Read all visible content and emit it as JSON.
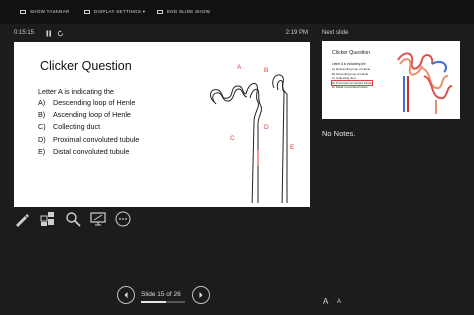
{
  "topbar": {
    "show_taskbar": "SHOW TASKBAR",
    "display_settings": "DISPLAY SETTINGS ▾",
    "end_slide_show": "END SLIDE SHOW"
  },
  "timer": {
    "elapsed": "0:15:15",
    "clock": "2:19 PM"
  },
  "slide": {
    "title": "Clicker Question",
    "question": "Letter A is indicating the",
    "options": [
      {
        "letter": "A)",
        "text": "Descending loop of Henle"
      },
      {
        "letter": "B)",
        "text": "Ascending loop of Henle"
      },
      {
        "letter": "C)",
        "text": "Collecting duct"
      },
      {
        "letter": "D)",
        "text": "Proximal convoluted tubule"
      },
      {
        "letter": "E)",
        "text": "Distal convoluted tubule"
      }
    ],
    "diagram_labels": {
      "a": "A",
      "b": "B",
      "c": "C",
      "d": "D",
      "e": "E"
    }
  },
  "tools": [
    "pen-icon",
    "see-all-slides-icon",
    "zoom-icon",
    "screen-icon",
    "more-options-icon"
  ],
  "next_slide": {
    "label": "Next slide",
    "title": "Clicker Question",
    "question": "Letter A is indicating the",
    "options": [
      "A)  Descending loop of Henle",
      "B)  Ascending loop of Henle",
      "C)  Collecting duct",
      "D)  Proximal convoluted tubule",
      "E)  Distal convoluted tubule"
    ]
  },
  "notes": {
    "text": "No Notes."
  },
  "navigation": {
    "counter": "Slide 15 of 26",
    "progress_fraction": 0.577
  },
  "font_controls": {
    "increase": "A",
    "decrease": "A"
  },
  "colors": {
    "background": "#1c1c1c",
    "label_red": "#e03a3a"
  }
}
